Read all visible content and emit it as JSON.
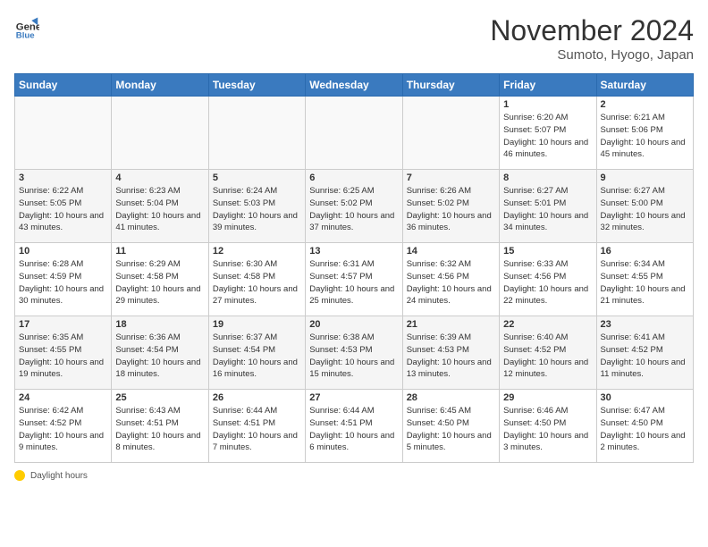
{
  "header": {
    "logo_line1": "General",
    "logo_line2": "Blue",
    "month": "November 2024",
    "location": "Sumoto, Hyogo, Japan"
  },
  "days_of_week": [
    "Sunday",
    "Monday",
    "Tuesday",
    "Wednesday",
    "Thursday",
    "Friday",
    "Saturday"
  ],
  "weeks": [
    [
      {
        "day": "",
        "info": ""
      },
      {
        "day": "",
        "info": ""
      },
      {
        "day": "",
        "info": ""
      },
      {
        "day": "",
        "info": ""
      },
      {
        "day": "",
        "info": ""
      },
      {
        "day": "1",
        "info": "Sunrise: 6:20 AM\nSunset: 5:07 PM\nDaylight: 10 hours and 46 minutes."
      },
      {
        "day": "2",
        "info": "Sunrise: 6:21 AM\nSunset: 5:06 PM\nDaylight: 10 hours and 45 minutes."
      }
    ],
    [
      {
        "day": "3",
        "info": "Sunrise: 6:22 AM\nSunset: 5:05 PM\nDaylight: 10 hours and 43 minutes."
      },
      {
        "day": "4",
        "info": "Sunrise: 6:23 AM\nSunset: 5:04 PM\nDaylight: 10 hours and 41 minutes."
      },
      {
        "day": "5",
        "info": "Sunrise: 6:24 AM\nSunset: 5:03 PM\nDaylight: 10 hours and 39 minutes."
      },
      {
        "day": "6",
        "info": "Sunrise: 6:25 AM\nSunset: 5:02 PM\nDaylight: 10 hours and 37 minutes."
      },
      {
        "day": "7",
        "info": "Sunrise: 6:26 AM\nSunset: 5:02 PM\nDaylight: 10 hours and 36 minutes."
      },
      {
        "day": "8",
        "info": "Sunrise: 6:27 AM\nSunset: 5:01 PM\nDaylight: 10 hours and 34 minutes."
      },
      {
        "day": "9",
        "info": "Sunrise: 6:27 AM\nSunset: 5:00 PM\nDaylight: 10 hours and 32 minutes."
      }
    ],
    [
      {
        "day": "10",
        "info": "Sunrise: 6:28 AM\nSunset: 4:59 PM\nDaylight: 10 hours and 30 minutes."
      },
      {
        "day": "11",
        "info": "Sunrise: 6:29 AM\nSunset: 4:58 PM\nDaylight: 10 hours and 29 minutes."
      },
      {
        "day": "12",
        "info": "Sunrise: 6:30 AM\nSunset: 4:58 PM\nDaylight: 10 hours and 27 minutes."
      },
      {
        "day": "13",
        "info": "Sunrise: 6:31 AM\nSunset: 4:57 PM\nDaylight: 10 hours and 25 minutes."
      },
      {
        "day": "14",
        "info": "Sunrise: 6:32 AM\nSunset: 4:56 PM\nDaylight: 10 hours and 24 minutes."
      },
      {
        "day": "15",
        "info": "Sunrise: 6:33 AM\nSunset: 4:56 PM\nDaylight: 10 hours and 22 minutes."
      },
      {
        "day": "16",
        "info": "Sunrise: 6:34 AM\nSunset: 4:55 PM\nDaylight: 10 hours and 21 minutes."
      }
    ],
    [
      {
        "day": "17",
        "info": "Sunrise: 6:35 AM\nSunset: 4:55 PM\nDaylight: 10 hours and 19 minutes."
      },
      {
        "day": "18",
        "info": "Sunrise: 6:36 AM\nSunset: 4:54 PM\nDaylight: 10 hours and 18 minutes."
      },
      {
        "day": "19",
        "info": "Sunrise: 6:37 AM\nSunset: 4:54 PM\nDaylight: 10 hours and 16 minutes."
      },
      {
        "day": "20",
        "info": "Sunrise: 6:38 AM\nSunset: 4:53 PM\nDaylight: 10 hours and 15 minutes."
      },
      {
        "day": "21",
        "info": "Sunrise: 6:39 AM\nSunset: 4:53 PM\nDaylight: 10 hours and 13 minutes."
      },
      {
        "day": "22",
        "info": "Sunrise: 6:40 AM\nSunset: 4:52 PM\nDaylight: 10 hours and 12 minutes."
      },
      {
        "day": "23",
        "info": "Sunrise: 6:41 AM\nSunset: 4:52 PM\nDaylight: 10 hours and 11 minutes."
      }
    ],
    [
      {
        "day": "24",
        "info": "Sunrise: 6:42 AM\nSunset: 4:52 PM\nDaylight: 10 hours and 9 minutes."
      },
      {
        "day": "25",
        "info": "Sunrise: 6:43 AM\nSunset: 4:51 PM\nDaylight: 10 hours and 8 minutes."
      },
      {
        "day": "26",
        "info": "Sunrise: 6:44 AM\nSunset: 4:51 PM\nDaylight: 10 hours and 7 minutes."
      },
      {
        "day": "27",
        "info": "Sunrise: 6:44 AM\nSunset: 4:51 PM\nDaylight: 10 hours and 6 minutes."
      },
      {
        "day": "28",
        "info": "Sunrise: 6:45 AM\nSunset: 4:50 PM\nDaylight: 10 hours and 5 minutes."
      },
      {
        "day": "29",
        "info": "Sunrise: 6:46 AM\nSunset: 4:50 PM\nDaylight: 10 hours and 3 minutes."
      },
      {
        "day": "30",
        "info": "Sunrise: 6:47 AM\nSunset: 4:50 PM\nDaylight: 10 hours and 2 minutes."
      }
    ]
  ],
  "footer": {
    "label": "Daylight hours"
  }
}
